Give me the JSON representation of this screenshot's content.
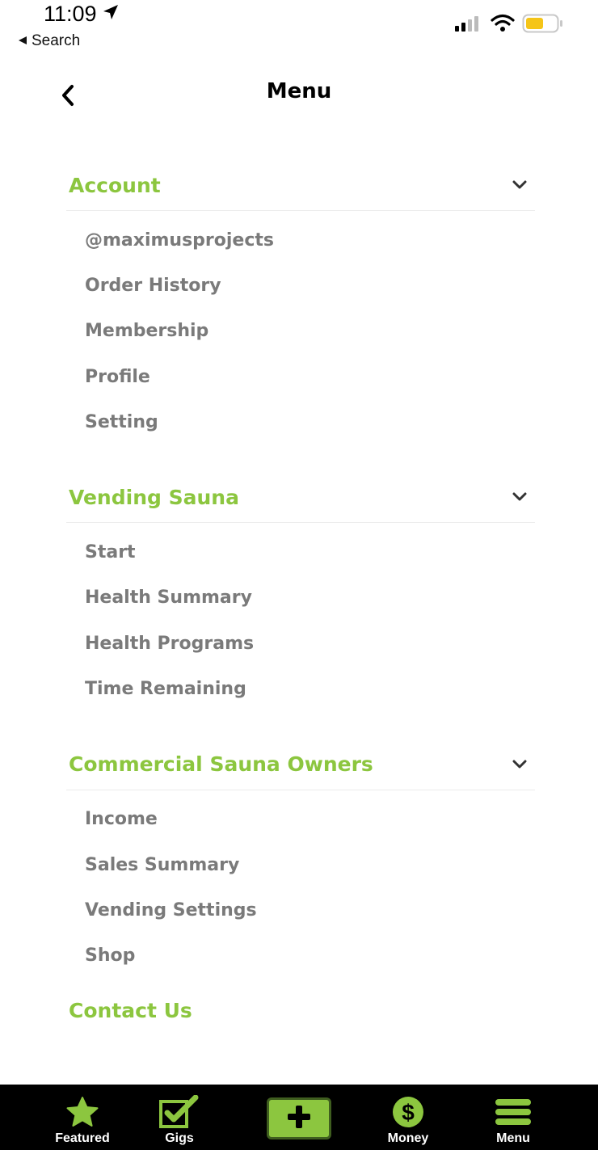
{
  "status_bar": {
    "time": "11:09",
    "back_label": "Search",
    "icons": [
      "location-arrow-icon",
      "signal-icon",
      "wifi-icon",
      "battery-icon"
    ],
    "battery_color": "#f5c518"
  },
  "header": {
    "title": "Menu",
    "back_icon": "chevron-left-icon"
  },
  "colors": {
    "accent": "#8cc63f",
    "item_text": "#7a7a7a",
    "nav_background": "#000000"
  },
  "sections": [
    {
      "title": "Account",
      "items": [
        "@maximusprojects",
        "Order History",
        "Membership",
        "Profile",
        "Setting"
      ]
    },
    {
      "title": "Vending Sauna",
      "items": [
        "Start",
        "Health Summary",
        "Health Programs",
        "Time Remaining"
      ]
    },
    {
      "title": "Commercial Sauna Owners",
      "items": [
        "Income",
        "Sales Summary",
        "Vending Settings",
        "Shop"
      ]
    }
  ],
  "contact": {
    "title": "Contact Us"
  },
  "bottom_nav": {
    "featured": {
      "label": "Featured",
      "icon": "star-icon"
    },
    "gigs": {
      "label": "Gigs",
      "icon": "checkbox-icon"
    },
    "add": {
      "label": "",
      "icon": "plus-icon"
    },
    "money": {
      "label": "Money",
      "icon": "dollar-icon"
    },
    "menu": {
      "label": "Menu",
      "icon": "hamburger-icon"
    }
  }
}
